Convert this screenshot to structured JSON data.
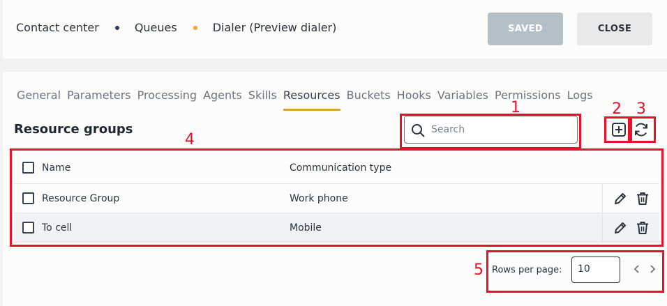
{
  "breadcrumbs": [
    {
      "label": "Contact center",
      "dot_color": "#2b3a55"
    },
    {
      "label": "Queues",
      "dot_color": "#f5a623"
    },
    {
      "label": "Dialer (Preview dialer)"
    }
  ],
  "buttons": {
    "saved": "SAVED",
    "close": "CLOSE"
  },
  "tabs": [
    "General",
    "Parameters",
    "Processing",
    "Agents",
    "Skills",
    "Resources",
    "Buckets",
    "Hooks",
    "Variables",
    "Permissions",
    "Logs"
  ],
  "active_tab": "Resources",
  "section": {
    "title": "Resource groups"
  },
  "search": {
    "placeholder": "Search",
    "value": ""
  },
  "toolbar_icons": {
    "add": "add-square-icon",
    "refresh": "refresh-icon"
  },
  "table": {
    "columns": {
      "name": "Name",
      "type": "Communication type"
    },
    "rows": [
      {
        "name": "Resource Group",
        "type": "Work phone"
      },
      {
        "name": "To cell",
        "type": "Mobile"
      }
    ]
  },
  "pagination": {
    "rows_per_page_label": "Rows per page:",
    "rows_per_page_value": "10"
  },
  "annotations": [
    "1",
    "2",
    "3",
    "4",
    "5"
  ],
  "colors": {
    "accent": "#e0a62a",
    "annotation": "#e8102a",
    "saved_button": "#b4c0c8"
  }
}
